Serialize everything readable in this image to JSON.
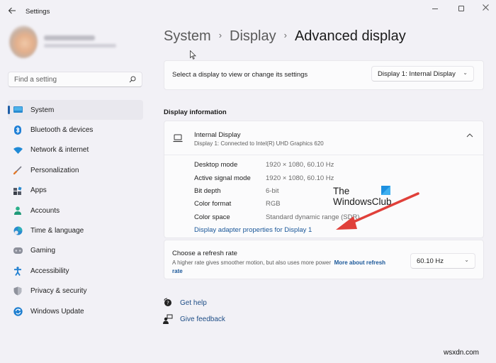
{
  "window": {
    "title": "Settings",
    "back_icon": "back-arrow-icon",
    "controls": [
      "minimize",
      "maximize",
      "close"
    ]
  },
  "search": {
    "placeholder": "Find a setting",
    "value": ""
  },
  "sidebar": {
    "items": [
      {
        "label": "System",
        "icon": "system-display-icon",
        "active": true
      },
      {
        "label": "Bluetooth & devices",
        "icon": "bluetooth-icon",
        "active": false
      },
      {
        "label": "Network & internet",
        "icon": "wifi-icon",
        "active": false
      },
      {
        "label": "Personalization",
        "icon": "paintbrush-icon",
        "active": false
      },
      {
        "label": "Apps",
        "icon": "apps-icon",
        "active": false
      },
      {
        "label": "Accounts",
        "icon": "person-icon",
        "active": false
      },
      {
        "label": "Time & language",
        "icon": "globe-clock-icon",
        "active": false
      },
      {
        "label": "Gaming",
        "icon": "gamepad-icon",
        "active": false
      },
      {
        "label": "Accessibility",
        "icon": "accessibility-icon",
        "active": false
      },
      {
        "label": "Privacy & security",
        "icon": "shield-icon",
        "active": false
      },
      {
        "label": "Windows Update",
        "icon": "update-icon",
        "active": false
      }
    ]
  },
  "breadcrumb": {
    "items": [
      "System",
      "Display",
      "Advanced display"
    ],
    "separator": "›"
  },
  "display_select": {
    "label": "Select a display to view or change its settings",
    "value": "Display 1: Internal Display"
  },
  "display_info": {
    "section_title": "Display information",
    "title": "Internal Display",
    "subtitle": "Display 1: Connected to Intel(R) UHD Graphics 620",
    "expanded": true,
    "specs": [
      {
        "key": "Desktop mode",
        "value": "1920 × 1080, 60.10 Hz"
      },
      {
        "key": "Active signal mode",
        "value": "1920 × 1080, 60.10 Hz"
      },
      {
        "key": "Bit depth",
        "value": "6-bit"
      },
      {
        "key": "Color format",
        "value": "RGB"
      },
      {
        "key": "Color space",
        "value": "Standard dynamic range (SDR)"
      }
    ],
    "adapter_link": "Display adapter properties for Display 1"
  },
  "refresh_rate": {
    "title": "Choose a refresh rate",
    "description": "A higher rate gives smoother motion, but also uses more power",
    "link": "More about refresh rate",
    "value": "60.10 Hz"
  },
  "help": {
    "get_help": "Get help",
    "give_feedback": "Give feedback"
  },
  "overlay": {
    "brand_line1": "The",
    "brand_line2": "WindowsClub",
    "watermark": "wsxdn.com",
    "arrow_color": "#e0403a"
  },
  "colors": {
    "accent": "#1f5fa8",
    "link": "#1a5799",
    "background": "#f2f1f6",
    "card": "#fbfbfc"
  }
}
